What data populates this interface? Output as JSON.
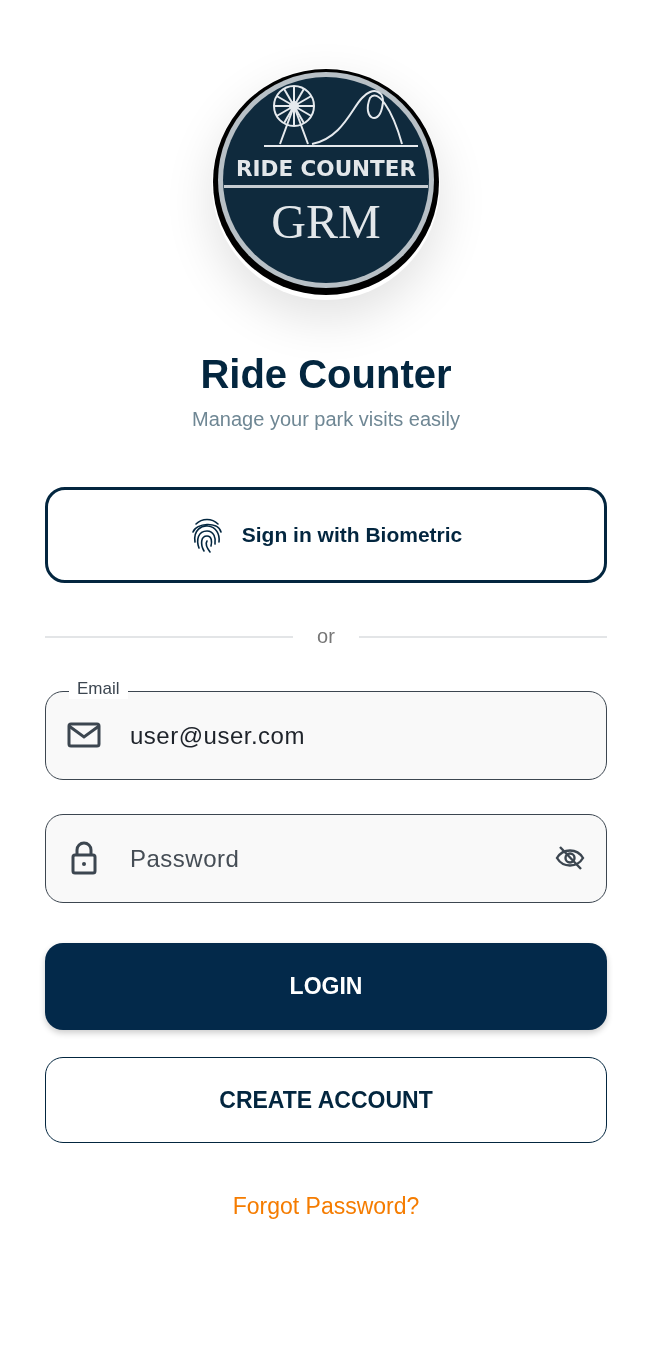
{
  "logo": {
    "title": "RIDE COUNTER",
    "monogram": "GRM"
  },
  "app_title": "Ride Counter",
  "subtitle": "Manage your park visits easily",
  "biometric_button": {
    "label": "Sign in with Biometric"
  },
  "divider_text": "or",
  "email_field": {
    "label": "Email",
    "value": "user@user.com"
  },
  "password_field": {
    "placeholder": "Password",
    "password_visible": false
  },
  "login_button": "LOGIN",
  "create_account_button": "CREATE ACCOUNT",
  "forgot_password_link": "Forgot Password?"
}
